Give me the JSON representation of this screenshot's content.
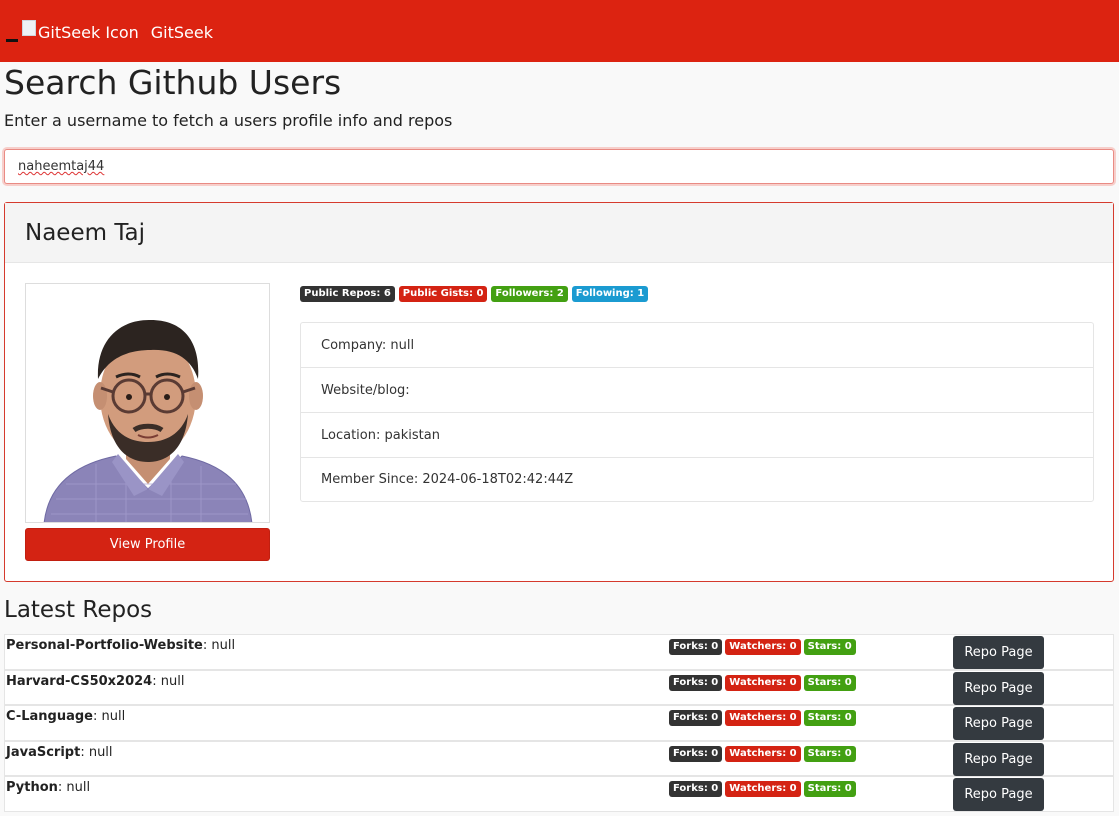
{
  "navbar": {
    "logo_alt": "GitSeek Icon",
    "brand": "GitSeek",
    "bg_color": "#dc2311"
  },
  "search": {
    "title": "Search Github Users",
    "subtitle": "Enter a username to fetch a users profile info and repos",
    "value": "naheemtaj44"
  },
  "profile": {
    "name": "Naeem Taj",
    "view_profile_label": "View Profile",
    "badges": {
      "public_repos": "Public Repos: 6",
      "public_gists": "Public Gists: 0",
      "followers": "Followers: 2",
      "following": "Following: 1"
    },
    "info": {
      "company": "Company: null",
      "website": "Website/blog:",
      "location": "Location: pakistan",
      "member_since": "Member Since: 2024-06-18T02:42:44Z"
    }
  },
  "repos": {
    "title": "Latest Repos",
    "button_label": "Repo Page",
    "items": [
      {
        "name": "Personal-Portfolio-Website",
        "desc": ": null",
        "forks": "Forks: 0",
        "watchers": "Watchers: 0",
        "stars": "Stars: 0"
      },
      {
        "name": "Harvard-CS50x2024",
        "desc": ": null",
        "forks": "Forks: 0",
        "watchers": "Watchers: 0",
        "stars": "Stars: 0"
      },
      {
        "name": "C-Language",
        "desc": ": null",
        "forks": "Forks: 0",
        "watchers": "Watchers: 0",
        "stars": "Stars: 0"
      },
      {
        "name": "JavaScript",
        "desc": ": null",
        "forks": "Forks: 0",
        "watchers": "Watchers: 0",
        "stars": "Stars: 0"
      },
      {
        "name": "Python",
        "desc": ": null",
        "forks": "Forks: 0",
        "watchers": "Watchers: 0",
        "stars": "Stars: 0"
      }
    ]
  }
}
